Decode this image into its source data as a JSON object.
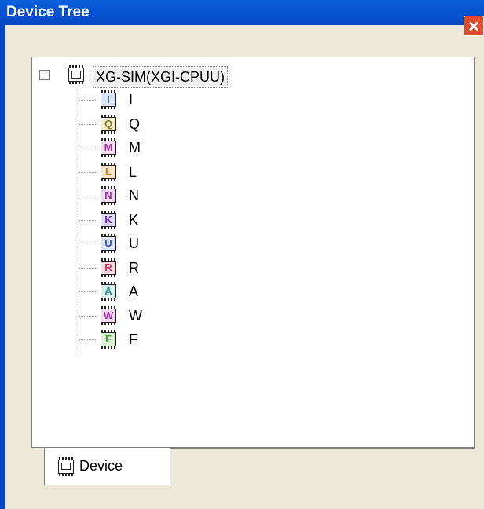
{
  "window": {
    "title": "Device Tree"
  },
  "tree": {
    "root": {
      "label": "XG-SIM(XGI-CPUU)",
      "expanded": true
    },
    "children": [
      {
        "label": "I",
        "glyph": "I",
        "color": "#5577cc",
        "fill": "#dde6ff"
      },
      {
        "label": "Q",
        "glyph": "Q",
        "color": "#887733",
        "fill": "#f2edc8"
      },
      {
        "label": "M",
        "glyph": "M",
        "color": "#aa3399",
        "fill": "#f6ddf0"
      },
      {
        "label": "L",
        "glyph": "L",
        "color": "#cc7722",
        "fill": "#fbe6c8"
      },
      {
        "label": "N",
        "glyph": "N",
        "color": "#993399",
        "fill": "#efd8f3"
      },
      {
        "label": "K",
        "glyph": "K",
        "color": "#6633cc",
        "fill": "#e3dbfa"
      },
      {
        "label": "U",
        "glyph": "U",
        "color": "#3355aa",
        "fill": "#dbe4fa"
      },
      {
        "label": "R",
        "glyph": "R",
        "color": "#cc3355",
        "fill": "#fadbe2"
      },
      {
        "label": "A",
        "glyph": "A",
        "color": "#338888",
        "fill": "#d8f1f0"
      },
      {
        "label": "W",
        "glyph": "W",
        "color": "#aa33aa",
        "fill": "#f3dbf6"
      },
      {
        "label": "F",
        "glyph": "F",
        "color": "#449933",
        "fill": "#dcf2d4"
      }
    ]
  },
  "tabs": [
    {
      "label": "Device",
      "icon": "chip-icon",
      "active": true
    }
  ]
}
